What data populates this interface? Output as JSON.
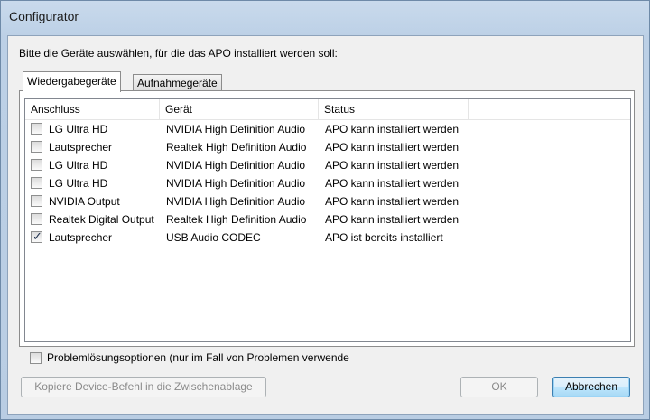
{
  "window": {
    "title": "Configurator"
  },
  "prompt": "Bitte die Geräte auswählen, für die das APO installiert werden soll:",
  "tabs": [
    {
      "label": "Wiedergabegeräte",
      "active": true
    },
    {
      "label": "Aufnahmegeräte",
      "active": false
    }
  ],
  "table": {
    "columns": [
      "Anschluss",
      "Gerät",
      "Status"
    ],
    "rows": [
      {
        "checked": false,
        "anschluss": "LG Ultra HD",
        "geraet": "NVIDIA High Definition Audio",
        "status": "APO kann installiert werden"
      },
      {
        "checked": false,
        "anschluss": "Lautsprecher",
        "geraet": "Realtek High Definition Audio",
        "status": "APO kann installiert werden"
      },
      {
        "checked": false,
        "anschluss": "LG Ultra HD",
        "geraet": "NVIDIA High Definition Audio",
        "status": "APO kann installiert werden"
      },
      {
        "checked": false,
        "anschluss": "LG Ultra HD",
        "geraet": "NVIDIA High Definition Audio",
        "status": "APO kann installiert werden"
      },
      {
        "checked": false,
        "anschluss": "NVIDIA Output",
        "geraet": "NVIDIA High Definition Audio",
        "status": "APO kann installiert werden"
      },
      {
        "checked": false,
        "anschluss": "Realtek Digital Output",
        "geraet": "Realtek High Definition Audio",
        "status": "APO kann installiert werden"
      },
      {
        "checked": true,
        "anschluss": "Lautsprecher",
        "geraet": "USB Audio CODEC",
        "status": "APO ist bereits installiert"
      }
    ]
  },
  "troubleshoot": {
    "label": "Problemlösungsoptionen (nur im Fall von Problemen verwende",
    "checked": false
  },
  "buttons": {
    "copy": "Kopiere Device-Befehl in die Zwischenablage",
    "ok": "OK",
    "cancel": "Abbrechen"
  }
}
